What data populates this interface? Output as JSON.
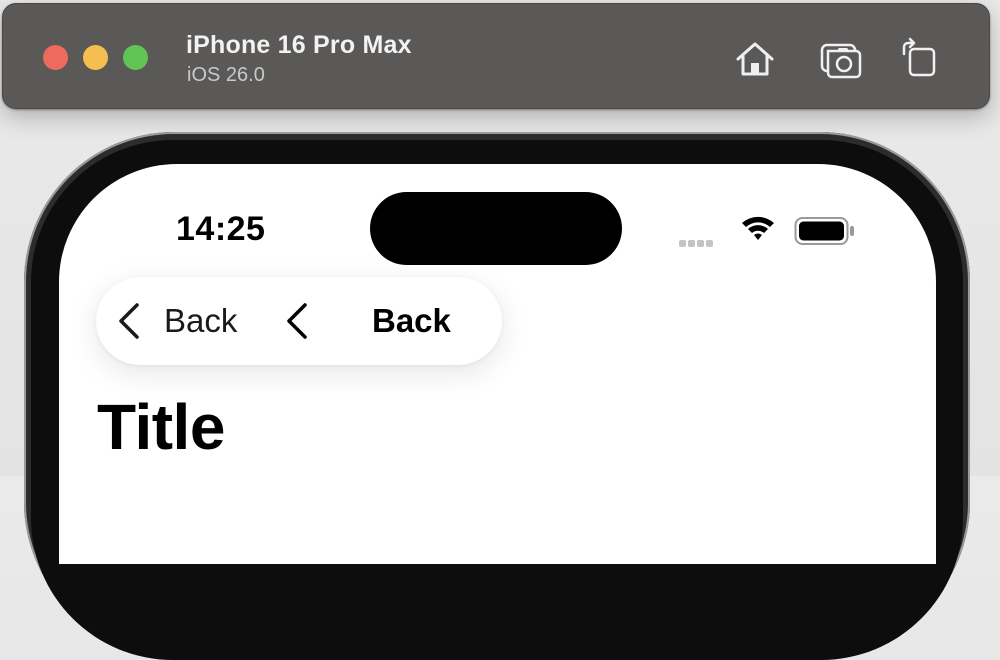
{
  "window": {
    "device_name": "iPhone 16 Pro Max",
    "os_version": "iOS 26.0",
    "buttons": {
      "home_icon": "home-icon",
      "screenshot_icon": "camera-icon",
      "rotate_icon": "rotate-icon"
    },
    "traffic_lights": [
      "#ed6a5e",
      "#f5bf4f",
      "#61c454"
    ]
  },
  "status_bar": {
    "time": "14:25",
    "icons": [
      "cellular-signal-icon",
      "wifi-icon",
      "battery-icon"
    ]
  },
  "nav_bar": {
    "back_primary": "Back",
    "back_secondary": "Back"
  },
  "page": {
    "title": "Title"
  }
}
